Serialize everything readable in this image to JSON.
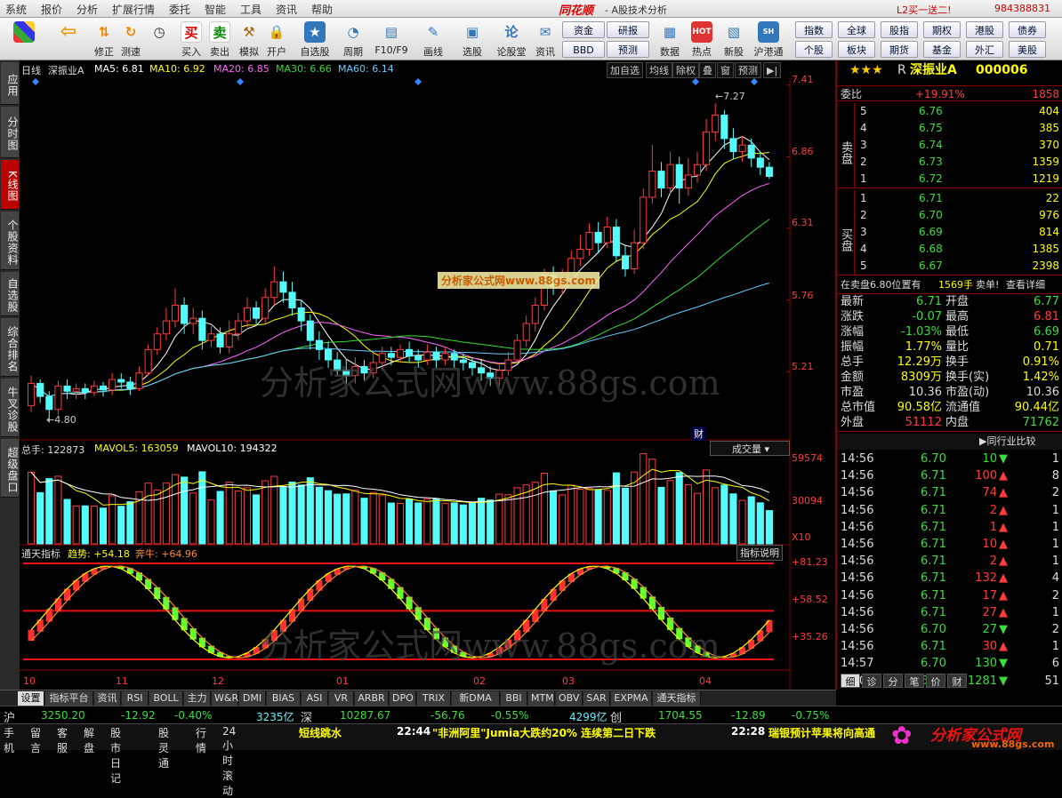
{
  "menu": {
    "items": [
      "系统",
      "报价",
      "分析",
      "扩展行情",
      "委托",
      "智能",
      "工具",
      "资讯",
      "帮助"
    ],
    "logo": "同花顺",
    "subtitle": "- A股技术分析",
    "promo": "L2买一送二!",
    "phone": "984388831"
  },
  "toolbar": {
    "buttons": [
      {
        "label": "",
        "icon": "grid-icon"
      },
      {
        "label": "",
        "icon": "back-arrow-icon"
      },
      {
        "label": "修正",
        "icon": "arrows-updown-icon"
      },
      {
        "label": "测速",
        "icon": "refresh-icon"
      },
      {
        "label": "",
        "icon": "clock-icon"
      },
      {
        "label": "买入",
        "icon": "buy-icon",
        "glyph": "买"
      },
      {
        "label": "卖出",
        "icon": "sell-icon",
        "glyph": "卖"
      },
      {
        "label": "模拟",
        "icon": "hammer-icon"
      },
      {
        "label": "开户",
        "icon": "lock-icon"
      },
      {
        "label": "自选股",
        "icon": "star-icon"
      },
      {
        "label": "周期",
        "icon": "cycle-icon"
      },
      {
        "label": "F10/F9",
        "icon": "f10-icon"
      },
      {
        "label": "画线",
        "icon": "pen-icon"
      },
      {
        "label": "选股",
        "icon": "chart-select-icon"
      },
      {
        "label": "论股堂",
        "icon": "forum-icon"
      },
      {
        "label": "资讯",
        "icon": "news-icon"
      },
      {
        "label": "数据",
        "icon": "data-icon"
      },
      {
        "label": "热点",
        "icon": "hot-icon"
      },
      {
        "label": "新股",
        "icon": "new-stock-icon"
      },
      {
        "label": "沪港通",
        "icon": "hk-connect-icon"
      }
    ],
    "small_buttons": [
      "资金",
      "研报",
      "BBD",
      "预测"
    ],
    "right_buttons": [
      "指数",
      "全球",
      "股指",
      "期权",
      "港股",
      "债券",
      "个股",
      "板块",
      "期货",
      "基金",
      "外汇",
      "美股"
    ]
  },
  "left_tabs": [
    "应用",
    "分时图",
    "K线图",
    "个股资料",
    "自选股",
    "综合排名",
    "牛叉诊股",
    "超级盘口"
  ],
  "chart": {
    "period": "日线",
    "stock_name": "深振业A",
    "ma": [
      {
        "label": "MA5: 6.81",
        "color": "#ffffff"
      },
      {
        "label": "MA10: 6.92",
        "color": "#ffff00"
      },
      {
        "label": "MA20: 6.85",
        "color": "#ff66ff"
      },
      {
        "label": "MA30: 6.66",
        "color": "#33dd33"
      },
      {
        "label": "MA60: 6.14",
        "color": "#66ccff"
      }
    ],
    "controls": [
      "加自选",
      "均线",
      "除权",
      "叠",
      "窗",
      "预测"
    ],
    "price_axis": [
      "7.41",
      "6.86",
      "6.31",
      "5.76",
      "5.21"
    ],
    "high_label": "7.27",
    "low_label": "4.80",
    "cai_label": "财",
    "watermark_small": "分析家公式网www.88gs.com",
    "watermark_big": "分析家公式网www.88gs.com",
    "volume_label": "总手: 122873",
    "mavol5": "MAVOL5: 163059",
    "mavol10": "MAVOL10: 194322",
    "vol_select": "成交量",
    "vol_axis": [
      "59574",
      "30094",
      "X10"
    ],
    "ind_name": "通天指标",
    "ind_trend": "趋势: +54.18",
    "ind_bull": "奔牛: +64.96",
    "ind_help": "指标说明",
    "ind_axis": [
      "+81.23",
      "+58.52",
      "+35.26"
    ],
    "months": [
      "10",
      "11",
      "12",
      "01",
      "02",
      "03",
      "04"
    ]
  },
  "chart_data": {
    "type": "candlestick",
    "title": "深振业A 日线",
    "ylim": [
      4.7,
      7.45
    ],
    "candles": [
      [
        4.95,
        5.12,
        5.18,
        4.9
      ],
      [
        5.12,
        5.02,
        5.15,
        4.97
      ],
      [
        5.02,
        4.92,
        5.06,
        4.82
      ],
      [
        4.92,
        5.1,
        5.14,
        4.88
      ],
      [
        5.1,
        5.06,
        5.15,
        5.0
      ],
      [
        5.06,
        5.08,
        5.12,
        5.0
      ],
      [
        5.08,
        5.05,
        5.12,
        5.0
      ],
      [
        5.05,
        5.1,
        5.14,
        5.02
      ],
      [
        5.1,
        5.07,
        5.13,
        5.02
      ],
      [
        5.07,
        5.15,
        5.2,
        5.03
      ],
      [
        5.15,
        5.13,
        5.2,
        5.08
      ],
      [
        5.13,
        5.08,
        5.17,
        5.03
      ],
      [
        5.08,
        5.2,
        5.25,
        5.06
      ],
      [
        5.2,
        5.38,
        5.42,
        5.18
      ],
      [
        5.38,
        5.5,
        5.55,
        5.34
      ],
      [
        5.5,
        5.6,
        5.7,
        5.45
      ],
      [
        5.6,
        5.72,
        5.85,
        5.55
      ],
      [
        5.72,
        5.58,
        5.78,
        5.5
      ],
      [
        5.58,
        5.62,
        5.7,
        5.5
      ],
      [
        5.62,
        5.45,
        5.68,
        5.38
      ],
      [
        5.45,
        5.5,
        5.56,
        5.4
      ],
      [
        5.5,
        5.4,
        5.55,
        5.35
      ],
      [
        5.4,
        5.5,
        5.6,
        5.35
      ],
      [
        5.5,
        5.6,
        5.66,
        5.45
      ],
      [
        5.6,
        5.7,
        5.78,
        5.55
      ],
      [
        5.7,
        5.62,
        5.75,
        5.56
      ],
      [
        5.62,
        5.78,
        5.85,
        5.58
      ],
      [
        5.78,
        5.9,
        6.02,
        5.72
      ],
      [
        5.9,
        5.82,
        5.98,
        5.74
      ],
      [
        5.82,
        5.7,
        5.9,
        5.64
      ],
      [
        5.7,
        5.6,
        5.76,
        5.52
      ],
      [
        5.6,
        5.45,
        5.65,
        5.38
      ],
      [
        5.45,
        5.38,
        5.52,
        5.3
      ],
      [
        5.38,
        5.3,
        5.44,
        5.24
      ],
      [
        5.3,
        5.22,
        5.36,
        5.18
      ],
      [
        5.22,
        5.18,
        5.3,
        5.12
      ],
      [
        5.18,
        5.25,
        5.32,
        5.12
      ],
      [
        5.25,
        5.2,
        5.3,
        5.14
      ],
      [
        5.2,
        5.28,
        5.35,
        5.16
      ],
      [
        5.28,
        5.35,
        5.4,
        5.22
      ],
      [
        5.35,
        5.32,
        5.4,
        5.26
      ],
      [
        5.32,
        5.38,
        5.42,
        5.28
      ],
      [
        5.38,
        5.33,
        5.44,
        5.28
      ],
      [
        5.33,
        5.3,
        5.38,
        5.24
      ],
      [
        5.3,
        5.36,
        5.42,
        5.26
      ],
      [
        5.36,
        5.3,
        5.4,
        5.24
      ],
      [
        5.3,
        5.35,
        5.4,
        5.26
      ],
      [
        5.35,
        5.3,
        5.38,
        5.24
      ],
      [
        5.3,
        5.28,
        5.35,
        5.22
      ],
      [
        5.28,
        5.24,
        5.32,
        5.18
      ],
      [
        5.24,
        5.2,
        5.3,
        5.14
      ],
      [
        5.2,
        5.16,
        5.25,
        5.1
      ],
      [
        5.16,
        5.22,
        5.28,
        5.1
      ],
      [
        5.22,
        5.3,
        5.36,
        5.18
      ],
      [
        5.3,
        5.45,
        5.5,
        5.28
      ],
      [
        5.45,
        5.58,
        5.64,
        5.4
      ],
      [
        5.58,
        5.72,
        5.78,
        5.52
      ],
      [
        5.72,
        5.95,
        6.0,
        5.68
      ],
      [
        5.95,
        5.86,
        6.02,
        5.8
      ],
      [
        5.86,
        5.92,
        6.0,
        5.8
      ],
      [
        5.92,
        6.08,
        6.14,
        5.88
      ],
      [
        6.08,
        6.15,
        6.26,
        6.02
      ],
      [
        6.15,
        6.28,
        6.35,
        6.1
      ],
      [
        6.28,
        6.2,
        6.36,
        6.12
      ],
      [
        6.2,
        6.32,
        6.4,
        6.16
      ],
      [
        6.32,
        6.1,
        6.38,
        6.05
      ],
      [
        6.1,
        6.0,
        6.18,
        5.94
      ],
      [
        6.0,
        6.2,
        6.3,
        5.96
      ],
      [
        6.2,
        6.55,
        6.62,
        6.15
      ],
      [
        6.55,
        6.75,
        6.95,
        6.5
      ],
      [
        6.75,
        6.62,
        6.82,
        6.55
      ],
      [
        6.62,
        6.8,
        6.9,
        6.58
      ],
      [
        6.8,
        6.62,
        6.86,
        6.5
      ],
      [
        6.62,
        6.72,
        6.85,
        6.56
      ],
      [
        6.72,
        6.8,
        6.9,
        6.66
      ],
      [
        6.8,
        7.05,
        7.15,
        6.75
      ],
      [
        7.05,
        7.18,
        7.27,
        6.98
      ],
      [
        7.18,
        7.0,
        7.22,
        6.92
      ],
      [
        7.0,
        6.9,
        7.08,
        6.84
      ],
      [
        6.9,
        6.95,
        7.02,
        6.82
      ],
      [
        6.95,
        6.85,
        7.0,
        6.78
      ],
      [
        6.85,
        6.78,
        6.9,
        6.72
      ],
      [
        6.78,
        6.71,
        6.82,
        6.69
      ]
    ],
    "volume_axis": [
      0,
      59574
    ],
    "indicator_axis": [
      35.26,
      81.23
    ]
  },
  "quote": {
    "stars": "★★★",
    "tag": "R",
    "name": "深振业A",
    "code": "000006",
    "weibi_label": "委比",
    "weibi_pct": "+19.91%",
    "weibi_val": "1858",
    "sell_label": "卖盘",
    "buy_label": "买盘",
    "asks": [
      {
        "lvl": "5",
        "price": "6.76",
        "vol": "404"
      },
      {
        "lvl": "4",
        "price": "6.75",
        "vol": "385"
      },
      {
        "lvl": "3",
        "price": "6.74",
        "vol": "370"
      },
      {
        "lvl": "2",
        "price": "6.73",
        "vol": "1359"
      },
      {
        "lvl": "1",
        "price": "6.72",
        "vol": "1219"
      }
    ],
    "bids": [
      {
        "lvl": "1",
        "price": "6.71",
        "vol": "22"
      },
      {
        "lvl": "2",
        "price": "6.70",
        "vol": "976"
      },
      {
        "lvl": "3",
        "price": "6.69",
        "vol": "814"
      },
      {
        "lvl": "4",
        "price": "6.68",
        "vol": "1385"
      },
      {
        "lvl": "5",
        "price": "6.67",
        "vol": "2398"
      }
    ],
    "notice": "在卖盘6.80位置有",
    "notice_vol": "1569手",
    "notice_tail": "卖单!",
    "notice_link": "查看详细",
    "stats": [
      {
        "l1": "最新",
        "v1": "6.71",
        "c1": "green",
        "l2": "开盘",
        "v2": "6.77",
        "c2": "green"
      },
      {
        "l1": "涨跌",
        "v1": "-0.07",
        "c1": "green",
        "l2": "最高",
        "v2": "6.81",
        "c2": "red"
      },
      {
        "l1": "涨幅",
        "v1": "-1.03%",
        "c1": "green",
        "l2": "最低",
        "v2": "6.69",
        "c2": "green"
      },
      {
        "l1": "振幅",
        "v1": "1.77%",
        "c1": "yellow",
        "l2": "量比",
        "v2": "0.71",
        "c2": "yellow"
      },
      {
        "l1": "总手",
        "v1": "12.29万",
        "c1": "yellow",
        "l2": "换手",
        "v2": "0.91%",
        "c2": "yellow"
      },
      {
        "l1": "金额",
        "v1": "8309万",
        "c1": "yellow",
        "l2": "换手(实)",
        "v2": "1.42%",
        "c2": "yellow"
      },
      {
        "l1": "市盈",
        "v1": "10.36",
        "c1": "white",
        "l2": "市盈(动)",
        "v2": "10.36",
        "c2": "white"
      },
      {
        "l1": "总市值",
        "v1": "90.58亿",
        "c1": "yellow",
        "l2": "流通值",
        "v2": "90.44亿",
        "c2": "yellow"
      },
      {
        "l1": "外盘",
        "v1": "51112",
        "c1": "red",
        "l2": "内盘",
        "v2": "71762",
        "c2": "green"
      }
    ],
    "compare_label": "同行业比较",
    "ticks": [
      {
        "t": "14:56",
        "p": "6.70",
        "v": "10",
        "d": "down",
        "n": "1"
      },
      {
        "t": "14:56",
        "p": "6.71",
        "v": "100",
        "d": "up",
        "n": "8"
      },
      {
        "t": "14:56",
        "p": "6.71",
        "v": "74",
        "d": "up",
        "n": "2"
      },
      {
        "t": "14:56",
        "p": "6.71",
        "v": "2",
        "d": "up",
        "n": "1"
      },
      {
        "t": "14:56",
        "p": "6.71",
        "v": "1",
        "d": "up",
        "n": "1"
      },
      {
        "t": "14:56",
        "p": "6.71",
        "v": "10",
        "d": "up",
        "n": "1"
      },
      {
        "t": "14:56",
        "p": "6.71",
        "v": "2",
        "d": "up",
        "n": "1"
      },
      {
        "t": "14:56",
        "p": "6.71",
        "v": "132",
        "d": "up",
        "n": "4"
      },
      {
        "t": "14:56",
        "p": "6.71",
        "v": "17",
        "d": "up",
        "n": "2"
      },
      {
        "t": "14:56",
        "p": "6.71",
        "v": "27",
        "d": "up",
        "n": "1"
      },
      {
        "t": "14:56",
        "p": "6.70",
        "v": "27",
        "d": "down",
        "n": "2"
      },
      {
        "t": "14:56",
        "p": "6.71",
        "v": "30",
        "d": "up",
        "n": "1"
      },
      {
        "t": "14:57",
        "p": "6.70",
        "v": "130",
        "d": "down",
        "n": "6"
      },
      {
        "t": "15:00",
        "p": "6.71",
        "v": "1281",
        "d": "down",
        "n": "51"
      }
    ],
    "tabs": [
      "细",
      "诊",
      "分",
      "笔",
      "价",
      "财"
    ]
  },
  "bottom_tabs": [
    "设置",
    "指标平台",
    "资讯",
    "RSI",
    "BOLL",
    "主力",
    "W&R",
    "DMI",
    "BIAS",
    "ASI",
    "VR",
    "ARBR",
    "DPO",
    "TRIX",
    "新DMA",
    "BBI",
    "MTM",
    "OBV",
    "SAR",
    "EXPMA",
    "通天指标"
  ],
  "status": {
    "sh_label": "沪",
    "sh_idx": "3250.20",
    "sh_chg": "-12.92",
    "sh_pct": "-0.40%",
    "sh_amt": "3235亿",
    "sz_label": "深",
    "sz_idx": "10287.67",
    "sz_chg": "-56.76",
    "sz_pct": "-0.55%",
    "sz_amt": "4299亿",
    "cy_label": "创",
    "cy_idx": "1704.55",
    "cy_chg": "-12.89",
    "cy_pct": "-0.75%"
  },
  "news": {
    "items": [
      "手机",
      "留言",
      "客服",
      "解盘",
      "股市日记",
      "股灵通",
      "行情",
      "24小时滚动"
    ],
    "headline1": "短线跳水",
    "time1": "22:44",
    "headline2": "\"非洲阿里\"Jumia大跌约20% 连续第二日下跌",
    "time2": "22:28",
    "headline3": "瑞银预计苹果将向高通",
    "brand": "分析家公式网",
    "brand_url": "www.88gs.com"
  }
}
